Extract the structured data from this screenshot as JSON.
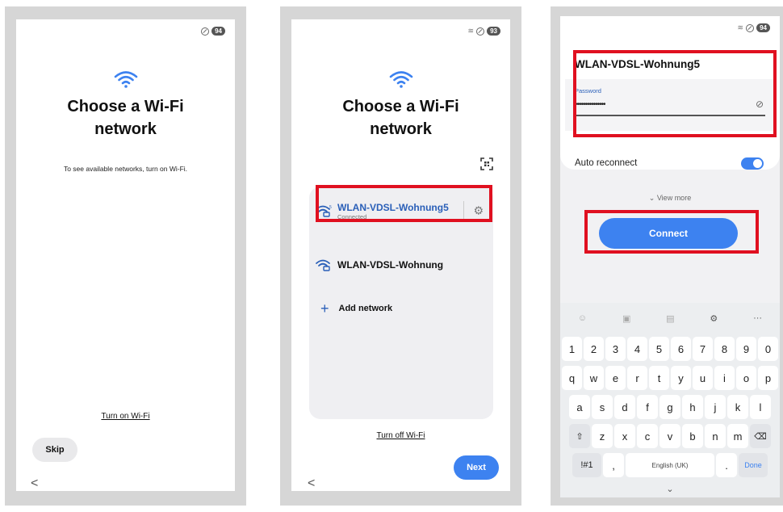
{
  "phone1": {
    "status": {
      "battery": "94"
    },
    "title_line1": "Choose a Wi-Fi",
    "title_line2": "network",
    "message": "To see available networks, turn on Wi-Fi.",
    "turn_on_link": "Turn on Wi-Fi",
    "skip_label": "Skip",
    "back_glyph": "<"
  },
  "phone2": {
    "status": {
      "battery": "93"
    },
    "title_line1": "Choose a Wi-Fi",
    "title_line2": "network",
    "networks": [
      {
        "name": "WLAN-VDSL-Wohnung5",
        "status": "Connected",
        "icon": "wifi-lock-5ghz-icon"
      },
      {
        "name": "WLAN-VDSL-Wohnung",
        "status": "",
        "icon": "wifi-lock-icon"
      }
    ],
    "add_network_label": "Add network",
    "turn_off_link": "Turn off Wi-Fi",
    "next_label": "Next",
    "back_glyph": "<"
  },
  "phone3": {
    "status": {
      "battery": "94"
    },
    "ssid": "WLAN-VDSL-Wohnung5",
    "password_label": "Password",
    "password_value": "•••••••••••••••",
    "auto_reconnect_label": "Auto reconnect",
    "auto_reconnect_on": true,
    "view_more_label": "View more",
    "connect_label": "Connect",
    "keyboard": {
      "row_numbers": [
        "1",
        "2",
        "3",
        "4",
        "5",
        "6",
        "7",
        "8",
        "9",
        "0"
      ],
      "row_q": [
        "q",
        "w",
        "e",
        "r",
        "t",
        "y",
        "u",
        "i",
        "o",
        "p"
      ],
      "row_a": [
        "a",
        "s",
        "d",
        "f",
        "g",
        "h",
        "j",
        "k",
        "l"
      ],
      "row_z": [
        "z",
        "x",
        "c",
        "v",
        "b",
        "n",
        "m"
      ],
      "symbols_key": "!#1",
      "comma_key": ",",
      "space_key": "English (UK)",
      "period_key": ".",
      "done_key": "Done"
    }
  },
  "colors": {
    "accent": "#3d82f0",
    "highlight_red": "#e01020"
  }
}
